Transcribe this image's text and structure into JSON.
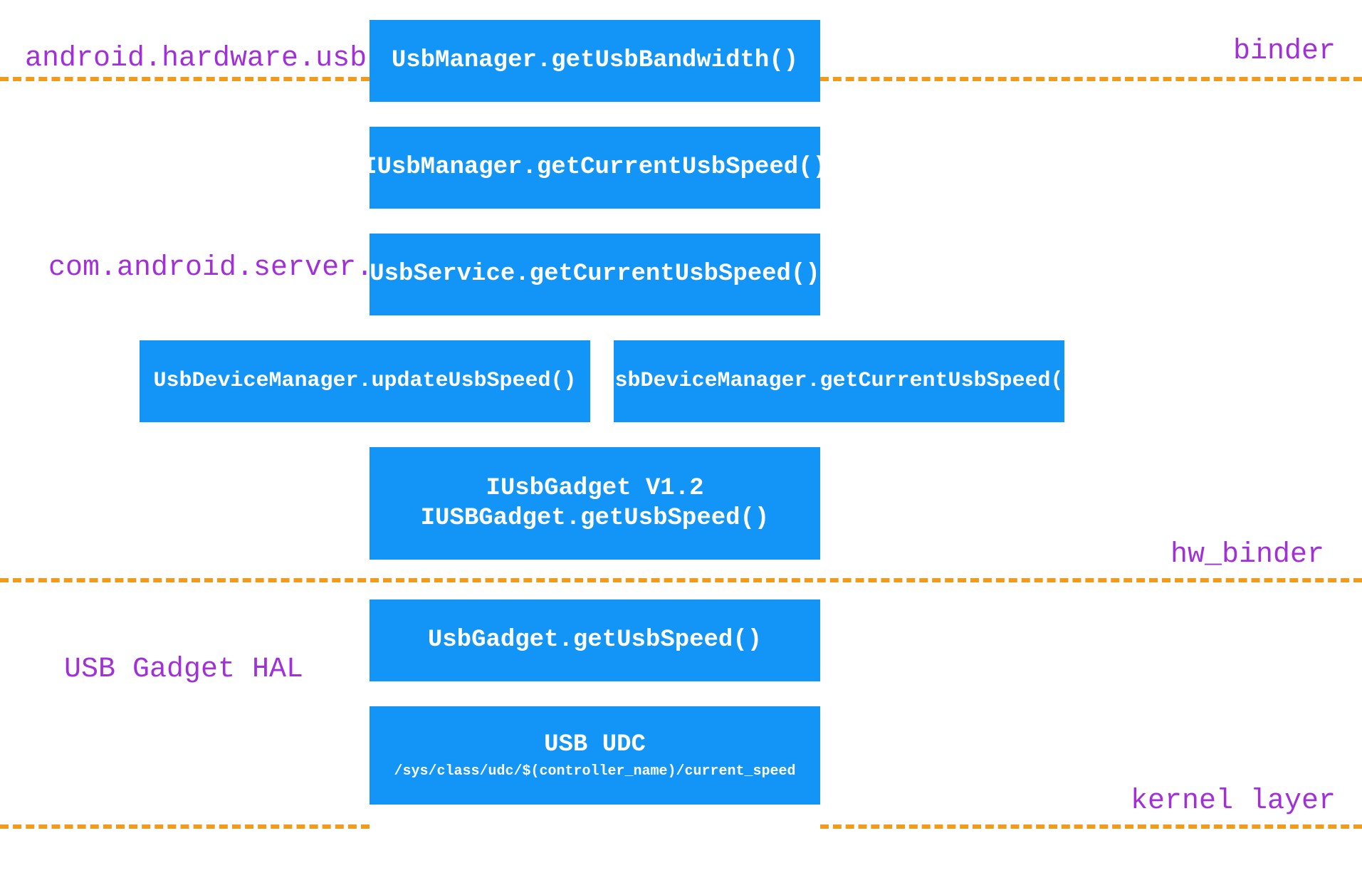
{
  "labels": {
    "android_hardware_usb": "android.hardware.usb",
    "binder": "binder",
    "com_android_server_usb": "com.android.server.usb",
    "hw_binder": "hw_binder",
    "usb_gadget_hal": "USB Gadget HAL",
    "kernel_layer": "kernel layer"
  },
  "boxes": {
    "usbmanager_getusbbandwidth": "UsbManager.getUsbBandwidth()",
    "iusbmanager_getcurrentusbspeed": "IUsbManager.getCurrentUsbSpeed()",
    "usbservice_getcurrentusbspeed": "UsbService.getCurrentUsbSpeed()",
    "usbdevicemanager_updateusbspeed": "UsbDeviceManager.updateUsbSpeed()",
    "usbdevicemanager_getcurrentusbspeed": "UsbDeviceManager.getCurrentUsbSpeed()",
    "iusbgadget_title": "IUsbGadget V1.2",
    "iusbgadget_sub": "IUSBGadget.getUsbSpeed()",
    "usbgadget_getusbspeed": "UsbGadget.getUsbSpeed()",
    "usb_udc_title": "USB UDC",
    "usb_udc_path": "/sys/class/udc/$(controller_name)/current_speed"
  }
}
